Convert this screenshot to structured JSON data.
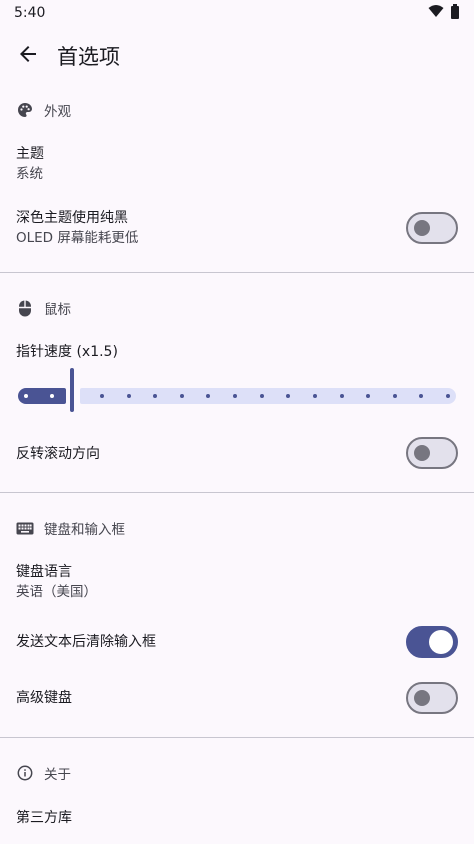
{
  "status": {
    "time": "5:40",
    "wifi_icon": "wifi-icon",
    "battery_icon": "battery-icon"
  },
  "appbar": {
    "title": "首选项",
    "back_icon": "arrow-back-icon"
  },
  "sections": {
    "appearance": {
      "header": "外观",
      "theme": {
        "title": "主题",
        "value": "系统"
      },
      "pure_black": {
        "title": "深色主题使用纯黑",
        "subtitle": "OLED 屏幕能耗更低",
        "enabled": false
      }
    },
    "mouse": {
      "header": "鼠标",
      "pointer_speed": {
        "title": "指针速度 (x1.5)",
        "value": 1.5,
        "min": 1.0,
        "max": 8.0,
        "step_count": 15,
        "current_step": 1
      },
      "reverse_scroll": {
        "title": "反转滚动方向",
        "enabled": false
      }
    },
    "keyboard": {
      "header": "键盘和输入框",
      "language": {
        "title": "键盘语言",
        "value": "英语（美国）"
      },
      "clear_input": {
        "title": "发送文本后清除输入框",
        "enabled": true
      },
      "advanced": {
        "title": "高级键盘",
        "enabled": false
      }
    },
    "about": {
      "header": "关于",
      "licenses": {
        "title": "第三方库"
      }
    }
  },
  "colors": {
    "accent": "#4a5494",
    "background": "#fcf8fd",
    "track_inactive": "#dde0f8",
    "outline": "#777680"
  }
}
